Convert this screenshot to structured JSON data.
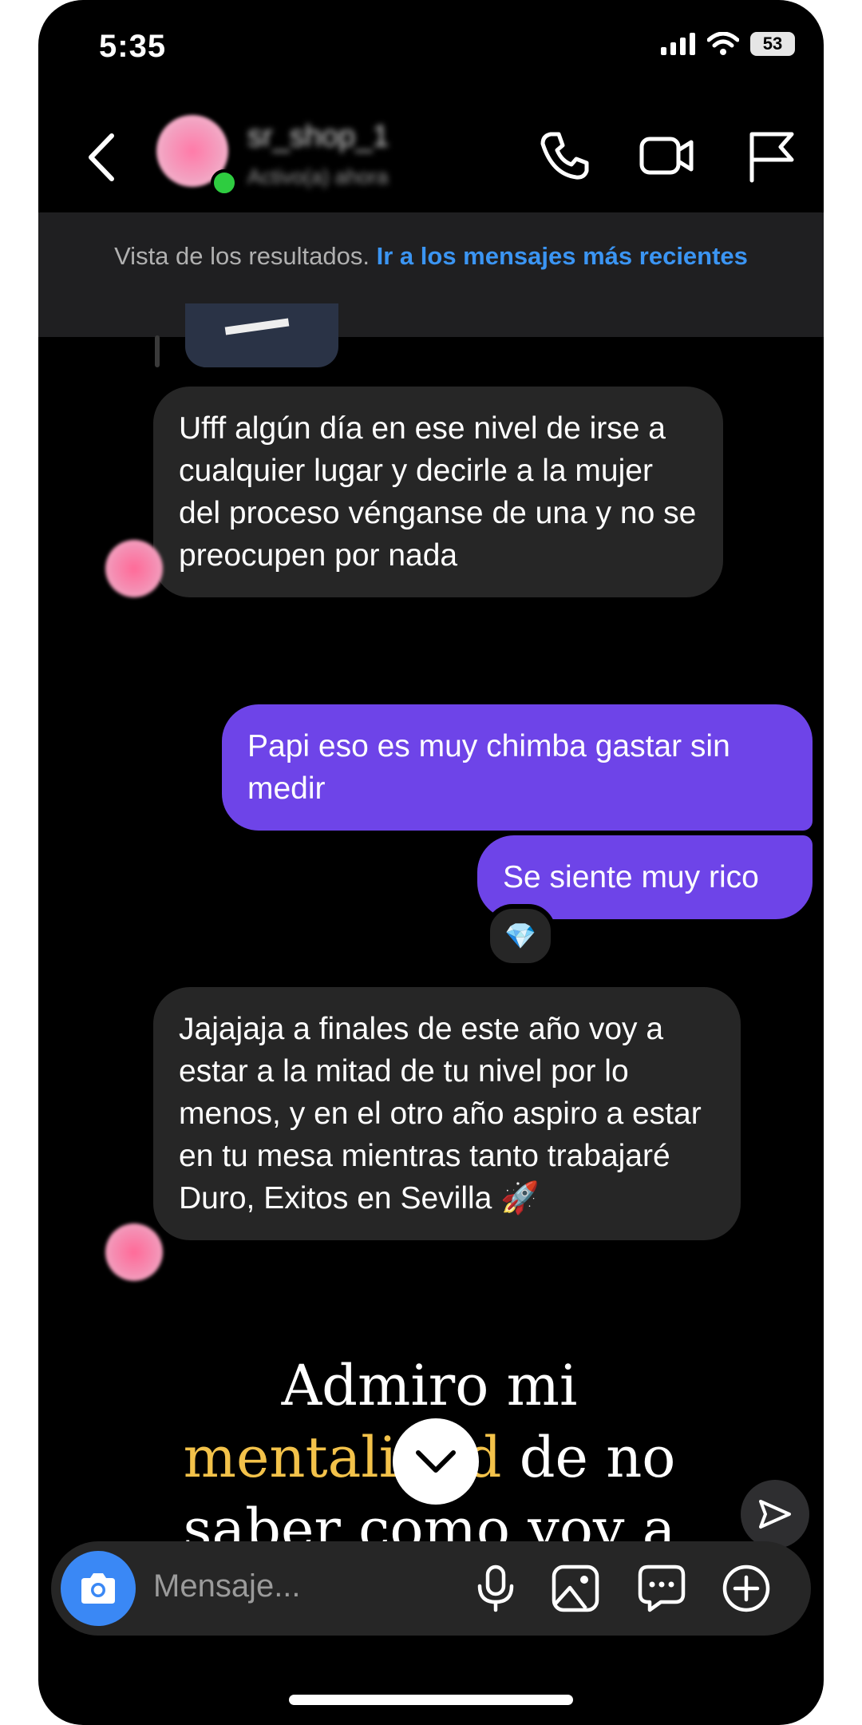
{
  "status_bar": {
    "time": "5:35",
    "battery": "53"
  },
  "header": {
    "username": "sr_shop_1",
    "activity": "Activo(a) ahora"
  },
  "banner": {
    "text": "Vista de los resultados.",
    "link": "Ir a los mensajes más recientes"
  },
  "messages": [
    {
      "direction": "incoming",
      "text": "Ufff algún día en ese nivel de irse a cualquier lugar y decirle a la mujer del proceso vénganse de una y no se preocupen por nada"
    },
    {
      "direction": "outgoing",
      "text": "Papi eso es muy chimba gastar sin medir"
    },
    {
      "direction": "outgoing",
      "text": "Se siente muy rico",
      "reaction": "💎"
    },
    {
      "direction": "incoming",
      "text": "Jajajaja a finales de este año voy a estar a la mitad de tu nivel por lo menos, y en el otro año aspiro a estar en tu mesa mientras tanto trabajaré Duro, Exitos en Sevilla 🚀"
    }
  ],
  "story_preview": {
    "line1": "Admiro mi",
    "line2_gold": "mentalidad",
    "line2_rest": " de no",
    "line3": "saber como voy a"
  },
  "composer": {
    "placeholder": "Mensaje..."
  },
  "icons": {
    "back": "chevron-left-icon",
    "call": "phone-icon",
    "video": "video-camera-icon",
    "report": "flag-icon",
    "camera": "camera-icon",
    "mic": "microphone-icon",
    "gallery": "image-icon",
    "sticker": "chat-bubble-icon",
    "more": "plus-circle-icon"
  },
  "colors": {
    "outgoing": "#6e44e8",
    "incoming": "#262626",
    "link": "#3b95f3",
    "online": "#2ecc40"
  }
}
